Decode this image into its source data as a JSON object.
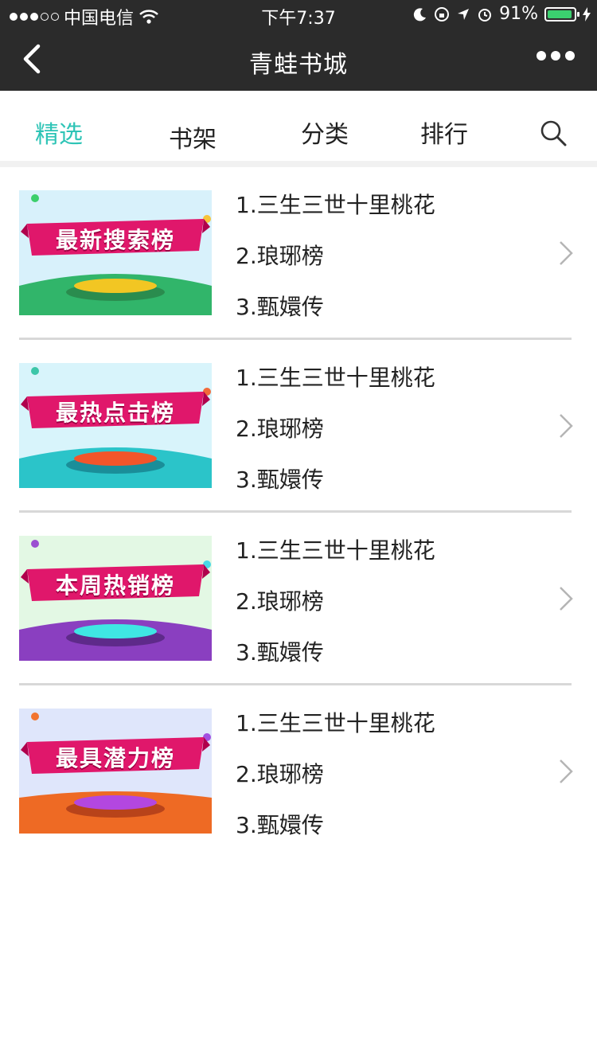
{
  "status_bar": {
    "carrier": "中国电信",
    "time": "下午7:37",
    "battery": "91%",
    "battery_level": 0.91
  },
  "nav": {
    "title": "青蛙书城"
  },
  "tabs": [
    {
      "label": "精选",
      "active": true
    },
    {
      "label": "书架"
    },
    {
      "label": "分类"
    },
    {
      "label": "排行"
    }
  ],
  "colors": {
    "accent": "#2ec4b6",
    "topbar": "#2b2b2b"
  },
  "rank_lists": [
    {
      "banner_title": "最新搜索榜",
      "books": [
        "1.三生三世十里桃花",
        "2.琅琊榜",
        "3.甄嬛传"
      ]
    },
    {
      "banner_title": "最热点击榜",
      "books": [
        "1.三生三世十里桃花",
        "2.琅琊榜",
        "3.甄嬛传"
      ]
    },
    {
      "banner_title": "本周热销榜",
      "books": [
        "1.三生三世十里桃花",
        "2.琅琊榜",
        "3.甄嬛传"
      ]
    },
    {
      "banner_title": "最具潜力榜",
      "books": [
        "1.三生三世十里桃花",
        "2.琅琊榜",
        "3.甄嬛传"
      ]
    }
  ]
}
